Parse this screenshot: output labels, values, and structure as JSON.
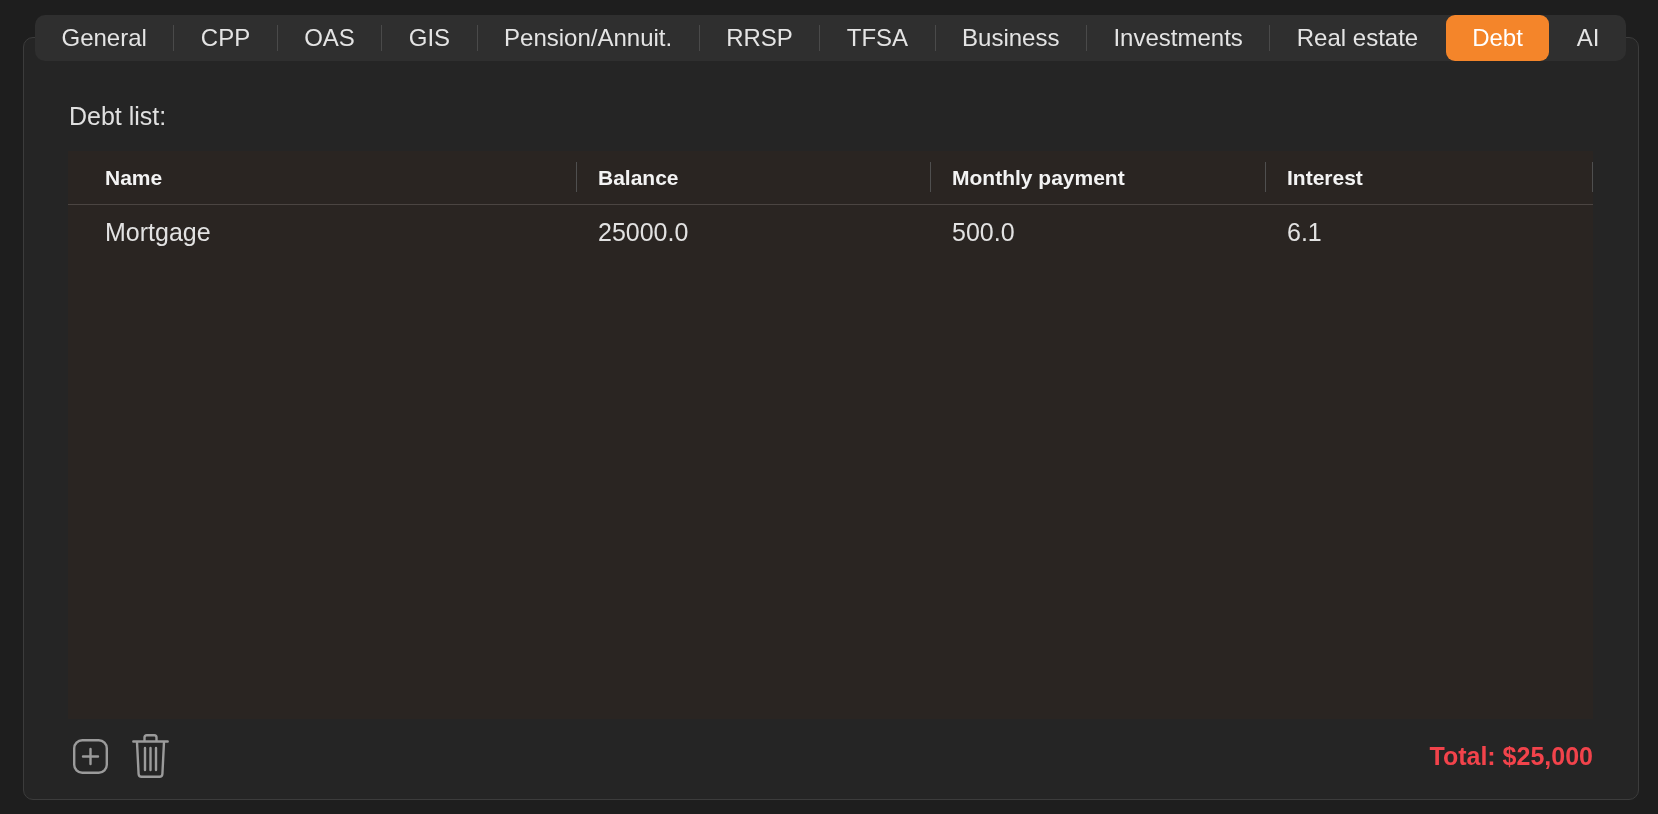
{
  "tabs": [
    {
      "label": "General",
      "selected": false
    },
    {
      "label": "CPP",
      "selected": false
    },
    {
      "label": "OAS",
      "selected": false
    },
    {
      "label": "GIS",
      "selected": false
    },
    {
      "label": "Pension/Annuit.",
      "selected": false
    },
    {
      "label": "RRSP",
      "selected": false
    },
    {
      "label": "TFSA",
      "selected": false
    },
    {
      "label": "Business",
      "selected": false
    },
    {
      "label": "Investments",
      "selected": false
    },
    {
      "label": "Real estate",
      "selected": false
    },
    {
      "label": "Debt",
      "selected": true
    },
    {
      "label": "AI",
      "selected": false
    }
  ],
  "debt_list": {
    "label": "Debt list:",
    "columns": [
      "Name",
      "Balance",
      "Monthly payment",
      "Interest"
    ],
    "rows": [
      {
        "cells": [
          "Mortgage",
          "25000.0",
          "500.0",
          "6.1"
        ]
      }
    ]
  },
  "footer": {
    "total": "Total: $25,000"
  }
}
